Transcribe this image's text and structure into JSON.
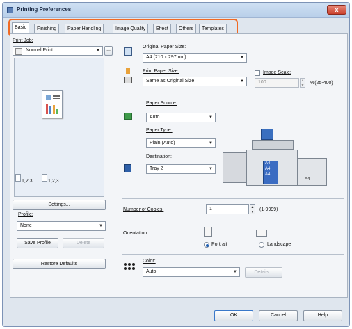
{
  "window": {
    "title": "Printing Preferences",
    "close_glyph": "x"
  },
  "tabs": [
    {
      "label": "Basic",
      "active": true
    },
    {
      "label": "Finishing"
    },
    {
      "label": "Paper Handling"
    },
    {
      "label": "Image Quality"
    },
    {
      "label": "Effect"
    },
    {
      "label": "Others"
    },
    {
      "label": "Templates"
    }
  ],
  "left": {
    "print_job_label": "Print Job:",
    "print_job_value": "Normal Print",
    "ellipsis": "...",
    "copies_a": "1,2,3",
    "copies_b": "1,2,3",
    "settings_button": "Settings...",
    "profile_label": "Profile:",
    "profile_value": "None",
    "save_profile": "Save Profile",
    "delete": "Delete",
    "restore_defaults": "Restore Defaults"
  },
  "right": {
    "original_paper_size_label": "Original Paper Size:",
    "original_paper_size_value": "A4 (210 x 297mm)",
    "print_paper_size_label": "Print Paper Size:",
    "print_paper_size_value": "Same as Original Size",
    "image_scale_label": "Image Scale:",
    "image_scale_value": "100",
    "image_scale_range": "%(25-400)",
    "paper_source_label": "Paper Source:",
    "paper_source_value": "Auto",
    "paper_type_label": "Paper Type:",
    "paper_type_value": "Plain (Auto)",
    "destination_label": "Destination:",
    "destination_value": "Tray 2",
    "tray_labels": [
      "A4",
      "A4",
      "A4",
      "A4"
    ],
    "number_of_copies_label": "Number of Copies:",
    "number_of_copies_value": "1",
    "copies_range": "(1-9999)",
    "orientation_label": "Orientation:",
    "portrait": "Portrait",
    "landscape": "Landscape",
    "color_label": "Color:",
    "color_value": "Auto",
    "details": "Details..."
  },
  "footer": {
    "ok": "OK",
    "cancel": "Cancel",
    "help": "Help"
  }
}
